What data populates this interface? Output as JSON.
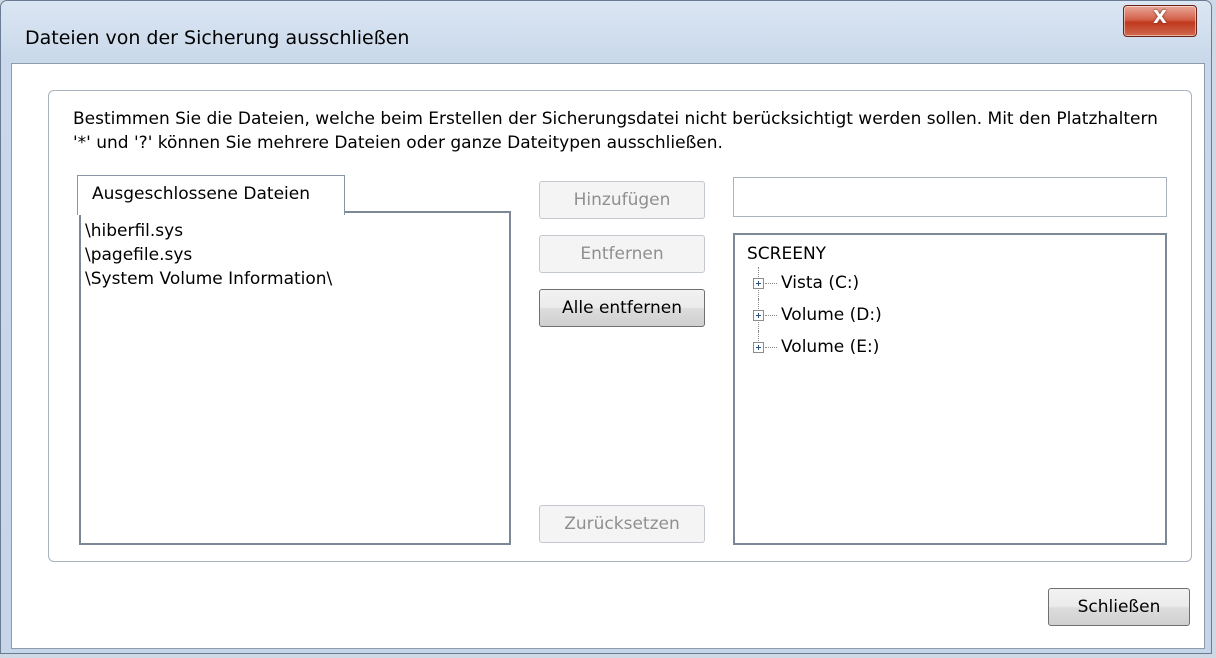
{
  "window": {
    "title": "Dateien von der Sicherung ausschließen",
    "close_glyph": "X"
  },
  "description": "Bestimmen Sie die Dateien, welche beim Erstellen der Sicherungsdatei nicht berücksichtigt werden sollen. Mit den Platzhaltern '*' und '?' können Sie mehrere Dateien oder ganze Dateitypen ausschließen.",
  "excluded": {
    "tab_label": "Ausgeschlossene Dateien",
    "items": [
      "\\hiberfil.sys",
      "\\pagefile.sys",
      "\\System Volume Information\\"
    ]
  },
  "buttons": {
    "add": "Hinzufügen",
    "remove": "Entfernen",
    "remove_all": "Alle entfernen",
    "reset": "Zurücksetzen",
    "close": "Schließen"
  },
  "path_input": {
    "value": ""
  },
  "tree": {
    "root": "SCREENY",
    "nodes": [
      "Vista (C:)",
      "Volume (D:)",
      "Volume (E:)"
    ]
  },
  "colors": {
    "close_button": "#c73b22",
    "window_frame": "#c9d8ea"
  }
}
